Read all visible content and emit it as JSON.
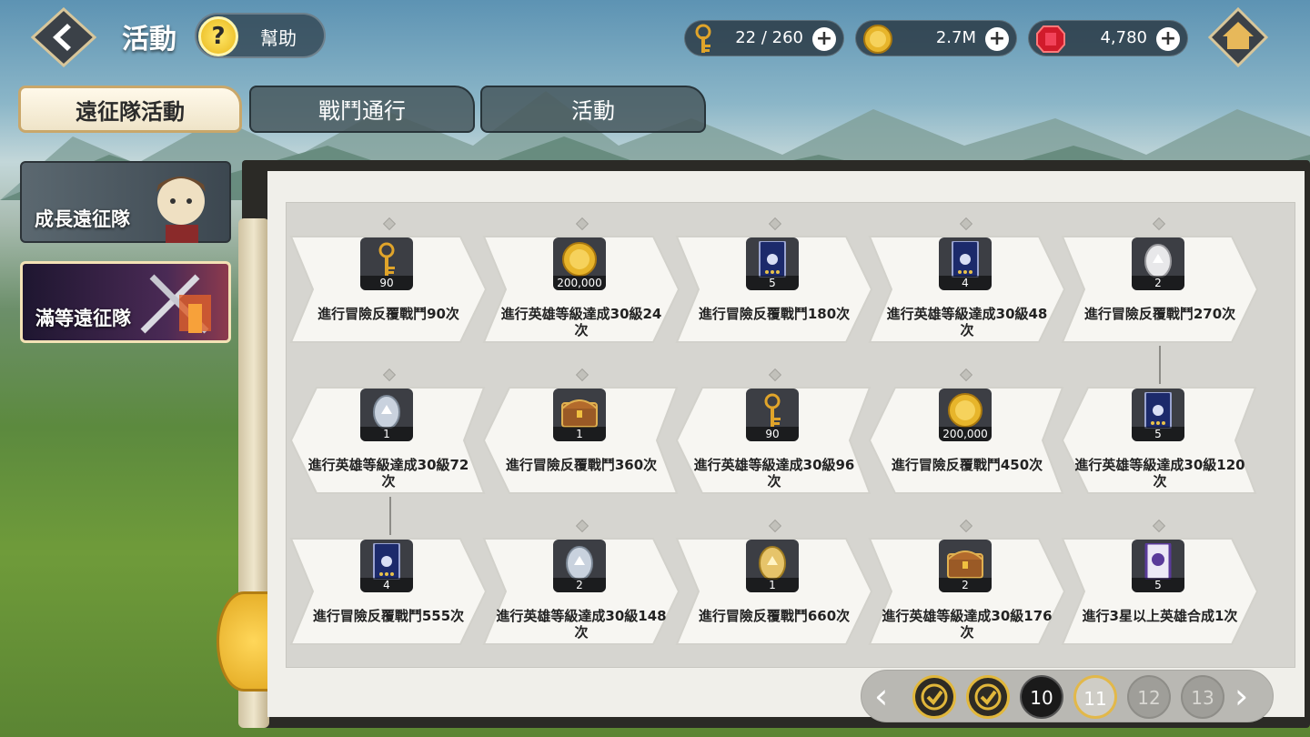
{
  "header": {
    "title": "活動",
    "help_label": "幫助",
    "help_icon": "?",
    "resources": [
      {
        "name": "key",
        "value": "22 / 260",
        "color": "#e0a42a"
      },
      {
        "name": "gold",
        "value": "2.7M",
        "color": "#e7b52b"
      },
      {
        "name": "gem",
        "value": "4,780",
        "color": "#d11b2b"
      }
    ],
    "plus_label": "+"
  },
  "tabs": [
    {
      "label": "遠征隊活動",
      "active": true
    },
    {
      "label": "戰鬥通行",
      "active": false
    },
    {
      "label": "活動",
      "active": false
    }
  ],
  "sidebar": [
    {
      "label": "成長遠征隊",
      "active": false
    },
    {
      "label": "滿等遠征隊",
      "active": true
    }
  ],
  "missions": [
    {
      "text": "進行冒險反覆戰鬥90次",
      "reward": "key",
      "count": "90"
    },
    {
      "text": "進行英雄等級達成30級24次",
      "reward": "gold",
      "count": "200,000"
    },
    {
      "text": "進行冒險反覆戰鬥180次",
      "reward": "card",
      "count": "5"
    },
    {
      "text": "進行英雄等級達成30級48次",
      "reward": "card",
      "count": "4"
    },
    {
      "text": "進行冒險反覆戰鬥270次",
      "reward": "egg-white",
      "count": "2"
    },
    {
      "text": "進行英雄等級達成30級120次",
      "reward": "card",
      "count": "5"
    },
    {
      "text": "進行冒險反覆戰鬥450次",
      "reward": "gold",
      "count": "200,000"
    },
    {
      "text": "進行英雄等級達成30級96次",
      "reward": "key",
      "count": "90"
    },
    {
      "text": "進行冒險反覆戰鬥360次",
      "reward": "chest",
      "count": "1"
    },
    {
      "text": "進行英雄等級達成30級72次",
      "reward": "egg-silver",
      "count": "1"
    },
    {
      "text": "進行冒險反覆戰鬥555次",
      "reward": "card",
      "count": "4"
    },
    {
      "text": "進行英雄等級達成30級148次",
      "reward": "egg-silver",
      "count": "2"
    },
    {
      "text": "進行冒險反覆戰鬥660次",
      "reward": "egg-gold",
      "count": "1"
    },
    {
      "text": "進行英雄等級達成30級176次",
      "reward": "chest",
      "count": "2"
    },
    {
      "text": "進行3星以上英雄合成1次",
      "reward": "scroll",
      "count": "5"
    }
  ],
  "pager": {
    "prev": "‹",
    "next": "›",
    "pages": [
      {
        "label": "",
        "state": "done"
      },
      {
        "label": "",
        "state": "done"
      },
      {
        "label": "10",
        "state": "current"
      },
      {
        "label": "11",
        "state": "next"
      },
      {
        "label": "12",
        "state": "locked"
      },
      {
        "label": "13",
        "state": "locked"
      }
    ]
  }
}
